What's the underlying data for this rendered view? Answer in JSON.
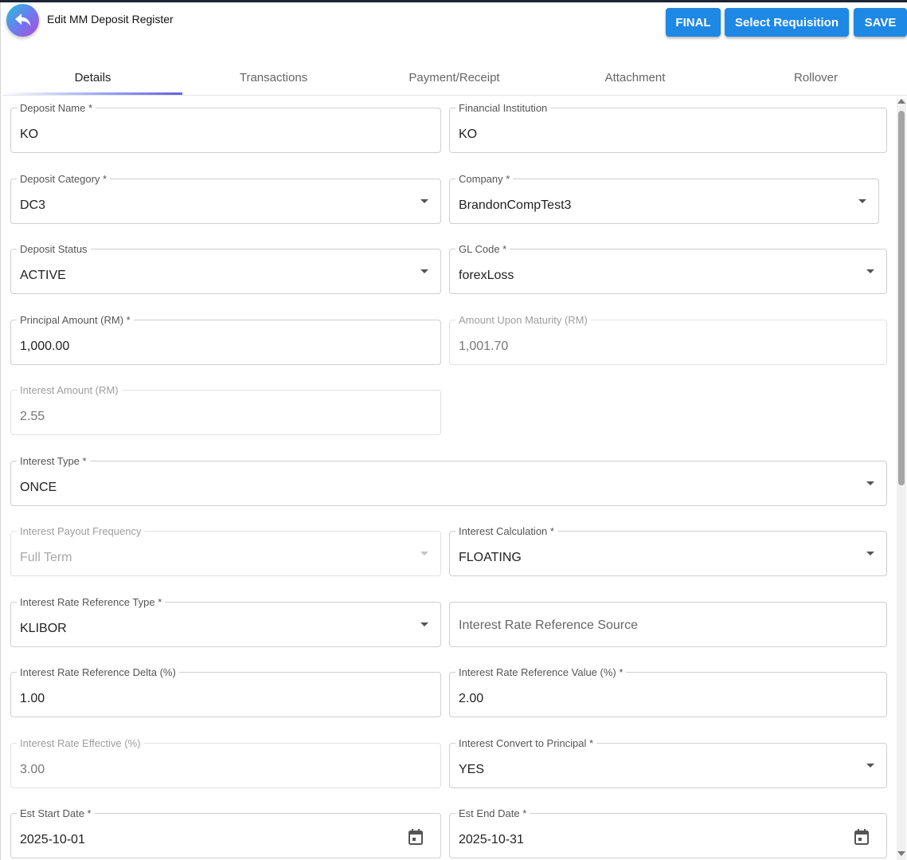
{
  "header": {
    "title": "Edit MM Deposit Register",
    "buttons": {
      "final": "FINAL",
      "select_requisition": "Select Requisition",
      "save": "SAVE"
    }
  },
  "tabs": [
    "Details",
    "Transactions",
    "Payment/Receipt",
    "Attachment",
    "Rollover"
  ],
  "active_tab": "Details",
  "fields": {
    "deposit_name": {
      "label": "Deposit Name *",
      "value": "KO"
    },
    "financial_institution": {
      "label": "Financial Institution",
      "value": "KO"
    },
    "deposit_category": {
      "label": "Deposit Category *",
      "value": "DC3"
    },
    "company": {
      "label": "Company *",
      "value": "BrandonCompTest3"
    },
    "deposit_status": {
      "label": "Deposit Status",
      "value": "ACTIVE"
    },
    "gl_code": {
      "label": "GL Code *",
      "value": "forexLoss"
    },
    "principal_amount": {
      "label": "Principal Amount (RM) *",
      "value": "1,000.00"
    },
    "amount_upon_maturity": {
      "label": "Amount Upon Maturity (RM)",
      "value": "1,001.70"
    },
    "interest_amount": {
      "label": "Interest Amount (RM)",
      "value": "2.55"
    },
    "interest_type": {
      "label": "Interest Type *",
      "value": "ONCE"
    },
    "interest_payout_frequency": {
      "label": "Interest Payout Frequency",
      "value": "Full Term"
    },
    "interest_calculation": {
      "label": "Interest Calculation *",
      "value": "FLOATING"
    },
    "interest_rate_reference_type": {
      "label": "Interest Rate Reference Type *",
      "value": "KLIBOR"
    },
    "interest_rate_reference_source": {
      "placeholder": "Interest Rate Reference Source"
    },
    "interest_rate_reference_delta": {
      "label": "Interest Rate Reference Delta (%)",
      "value": "1.00"
    },
    "interest_rate_reference_value": {
      "label": "Interest Rate Reference Value (%) *",
      "value": "2.00"
    },
    "interest_rate_effective": {
      "label": "Interest Rate Effective (%)",
      "value": "3.00"
    },
    "interest_convert_to_principal": {
      "label": "Interest Convert to Principal *",
      "value": "YES"
    },
    "est_start_date": {
      "label": "Est Start Date *",
      "value": "2025-10-01"
    },
    "est_end_date": {
      "label": "Est End Date *",
      "value": "2025-10-31"
    }
  },
  "colors": {
    "primary_button": "#1e88e5",
    "text": "#222222",
    "border": "#cfcfcf"
  }
}
